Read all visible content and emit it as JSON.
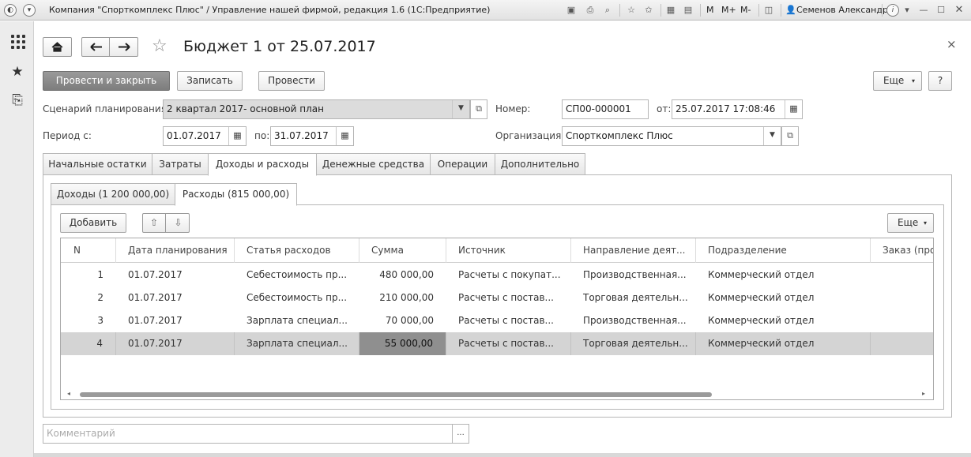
{
  "titlebar": {
    "title": "Компания \"Спорткомплекс Плюс\" / Управление нашей фирмой, редакция 1.6  (1С:Предприятие)",
    "m": "M",
    "mplus": "M+",
    "mminus": "M-",
    "user": "Семенов Александр",
    "info": "i"
  },
  "form": {
    "title": "Бюджет 1 от 25.07.2017",
    "close": "×"
  },
  "toolbar": {
    "post_close": "Провести и закрыть",
    "save": "Записать",
    "post": "Провести",
    "more": "Еще",
    "help": "?"
  },
  "fields": {
    "scenario_label": "Сценарий планирования:",
    "scenario_value": "2 квартал 2017- основной план",
    "number_label": "Номер:",
    "number_value": "СП00-000001",
    "from_label": "от:",
    "date_value": "25.07.2017 17:08:46",
    "period_label": "Период с:",
    "period_from": "01.07.2017",
    "period_to_label": "по:",
    "period_to": "31.07.2017",
    "org_label": "Организация:",
    "org_value": "Спорткомплекс Плюс",
    "comment_placeholder": "Комментарий",
    "comment_btn": "..."
  },
  "tabs": [
    {
      "label": "Начальные остатки"
    },
    {
      "label": "Затраты"
    },
    {
      "label": "Доходы и расходы"
    },
    {
      "label": "Денежные средства"
    },
    {
      "label": "Операции"
    },
    {
      "label": "Дополнительно"
    }
  ],
  "subtabs": [
    {
      "label": "Доходы (1 200 000,00)"
    },
    {
      "label": "Расходы (815 000,00)"
    }
  ],
  "table_toolbar": {
    "add": "Добавить",
    "more": "Еще"
  },
  "table": {
    "columns": [
      "N",
      "Дата планирования",
      "Статья расходов",
      "Сумма",
      "Источник",
      "Направление деят...",
      "Подразделение",
      "Заказ (про"
    ],
    "rows": [
      {
        "n": "1",
        "date": "01.07.2017",
        "article": "Себестоимость пр...",
        "sum": "480 000,00",
        "source": "Расчеты с покупат...",
        "direction": "Производственная...",
        "dept": "Коммерческий отдел"
      },
      {
        "n": "2",
        "date": "01.07.2017",
        "article": "Себестоимость пр...",
        "sum": "210 000,00",
        "source": "Расчеты с постав...",
        "direction": "Торговая деятельн...",
        "dept": "Коммерческий отдел"
      },
      {
        "n": "3",
        "date": "01.07.2017",
        "article": "Зарплата специал...",
        "sum": "70 000,00",
        "source": "Расчеты с постав...",
        "direction": "Производственная...",
        "dept": "Коммерческий отдел"
      },
      {
        "n": "4",
        "date": "01.07.2017",
        "article": "Зарплата специал...",
        "sum": "55 000,00",
        "source": "Расчеты с постав...",
        "direction": "Торговая деятельн...",
        "dept": "Коммерческий отдел"
      }
    ]
  }
}
